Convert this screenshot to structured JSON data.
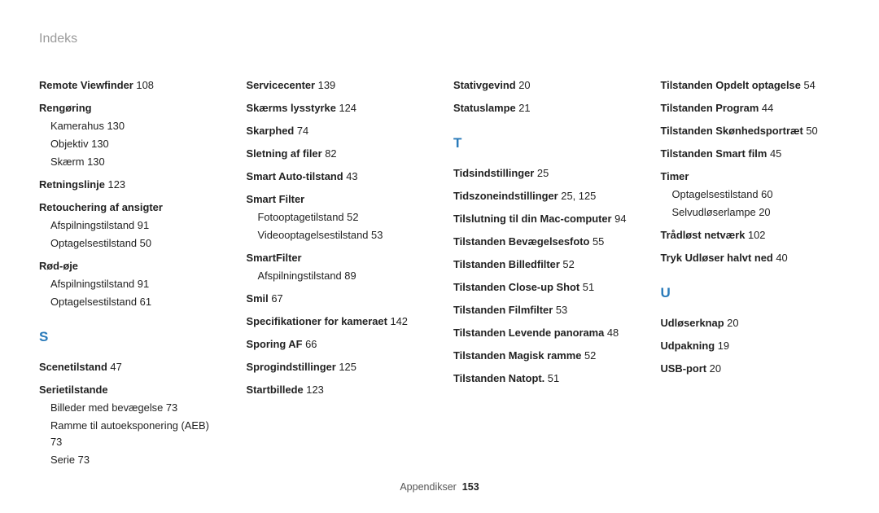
{
  "title": "Indeks",
  "footer": {
    "label": "Appendikser",
    "page": "153"
  },
  "col1": [
    {
      "type": "term",
      "text": "Remote Viewfinder",
      "pages": "108"
    },
    {
      "type": "term",
      "text": "Rengøring",
      "subs": [
        {
          "text": "Kamerahus",
          "pages": "130"
        },
        {
          "text": "Objektiv",
          "pages": "130"
        },
        {
          "text": "Skærm",
          "pages": "130"
        }
      ]
    },
    {
      "type": "term",
      "text": "Retningslinje",
      "pages": "123"
    },
    {
      "type": "term",
      "text": "Retouchering af ansigter",
      "subs": [
        {
          "text": "Afspilningstilstand",
          "pages": "91"
        },
        {
          "text": "Optagelsestilstand",
          "pages": "50"
        }
      ]
    },
    {
      "type": "term",
      "text": "Rød-øje",
      "subs": [
        {
          "text": "Afspilningstilstand",
          "pages": "91"
        },
        {
          "text": "Optagelsestilstand",
          "pages": "61"
        }
      ]
    },
    {
      "type": "letter",
      "text": "S"
    },
    {
      "type": "term",
      "text": "Scenetilstand",
      "pages": "47"
    },
    {
      "type": "term",
      "text": "Serietilstande",
      "subs": [
        {
          "text": "Billeder med bevægelse",
          "pages": "73"
        },
        {
          "text": "Ramme til autoeksponering (AEB)",
          "pages": "73"
        },
        {
          "text": "Serie",
          "pages": "73"
        }
      ]
    }
  ],
  "col2": [
    {
      "type": "term",
      "text": "Servicecenter",
      "pages": "139"
    },
    {
      "type": "term",
      "text": "Skærms lysstyrke",
      "pages": "124"
    },
    {
      "type": "term",
      "text": "Skarphed",
      "pages": "74"
    },
    {
      "type": "term",
      "text": "Sletning af filer",
      "pages": "82"
    },
    {
      "type": "term",
      "text": "Smart Auto-tilstand",
      "pages": "43"
    },
    {
      "type": "term",
      "text": "Smart Filter",
      "subs": [
        {
          "text": "Fotooptagetilstand",
          "pages": "52"
        },
        {
          "text": "Videooptagelsestilstand",
          "pages": "53"
        }
      ]
    },
    {
      "type": "term",
      "text": "SmartFilter",
      "subs": [
        {
          "text": "Afspilningstilstand",
          "pages": "89"
        }
      ]
    },
    {
      "type": "term",
      "text": "Smil",
      "pages": "67"
    },
    {
      "type": "term",
      "text": "Specifikationer for kameraet",
      "pages": "142"
    },
    {
      "type": "term",
      "text": "Sporing AF",
      "pages": "66"
    },
    {
      "type": "term",
      "text": "Sprogindstillinger",
      "pages": "125"
    },
    {
      "type": "term",
      "text": "Startbillede",
      "pages": "123"
    }
  ],
  "col3": [
    {
      "type": "term",
      "text": "Stativgevind",
      "pages": "20"
    },
    {
      "type": "term",
      "text": "Statuslampe",
      "pages": "21"
    },
    {
      "type": "letter",
      "text": "T"
    },
    {
      "type": "term",
      "text": "Tidsindstillinger",
      "pages": "25"
    },
    {
      "type": "term",
      "text": "Tidszoneindstillinger",
      "pages": "25, 125"
    },
    {
      "type": "term",
      "text": "Tilslutning til din Mac-computer",
      "pages": "94"
    },
    {
      "type": "term",
      "text": "Tilstanden Bevægelsesfoto",
      "pages": "55"
    },
    {
      "type": "term",
      "text": "Tilstanden Billedfilter",
      "pages": "52"
    },
    {
      "type": "term",
      "text": "Tilstanden Close-up Shot",
      "pages": "51"
    },
    {
      "type": "term",
      "text": "Tilstanden Filmfilter",
      "pages": "53"
    },
    {
      "type": "term",
      "text": "Tilstanden Levende panorama",
      "pages": "48"
    },
    {
      "type": "term",
      "text": "Tilstanden Magisk ramme",
      "pages": "52"
    },
    {
      "type": "term",
      "text": "Tilstanden Natopt.",
      "pages": "51"
    }
  ],
  "col4": [
    {
      "type": "term",
      "text": "Tilstanden Opdelt optagelse",
      "pages": "54"
    },
    {
      "type": "term",
      "text": "Tilstanden Program",
      "pages": "44"
    },
    {
      "type": "term",
      "text": "Tilstanden Skønhedsportræt",
      "pages": "50"
    },
    {
      "type": "term",
      "text": "Tilstanden Smart film",
      "pages": "45"
    },
    {
      "type": "term",
      "text": "Timer",
      "subs": [
        {
          "text": "Optagelsestilstand",
          "pages": "60"
        },
        {
          "text": "Selvudløserlampe",
          "pages": "20"
        }
      ]
    },
    {
      "type": "term",
      "text": "Trådløst netværk",
      "pages": "102"
    },
    {
      "type": "term",
      "text": "Tryk Udløser halvt ned",
      "pages": "40"
    },
    {
      "type": "letter",
      "text": "U"
    },
    {
      "type": "term",
      "text": "Udløserknap",
      "pages": "20"
    },
    {
      "type": "term",
      "text": "Udpakning",
      "pages": "19"
    },
    {
      "type": "term",
      "text": "USB-port",
      "pages": "20"
    }
  ]
}
